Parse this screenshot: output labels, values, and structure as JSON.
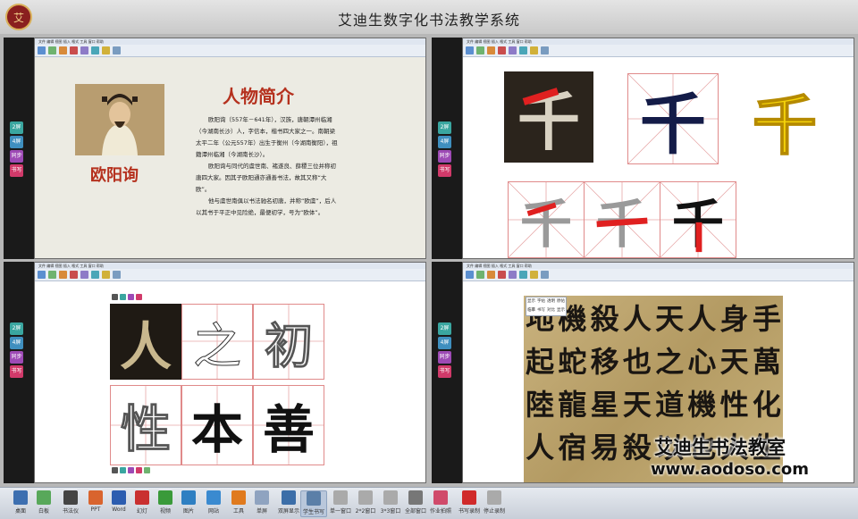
{
  "app": {
    "title": "艾迪生数字化书法教学系统",
    "logo_text": "艾"
  },
  "sidebar": {
    "buttons": [
      "2屏",
      "4屏",
      "同步",
      "书写"
    ]
  },
  "pane_menu": "文件 编辑 视图 插入 格式 工具 窗口 帮助",
  "pane1": {
    "title": "人物简介",
    "name": "欧阳询",
    "paragraphs": [
      "欧阳询（557年－641年），汉族，唐朝潭州临湘（今湖南长沙）人，字信本，楷书四大家之一。南朝梁太平二年（公元557年）出生于衡州（今湖南衡阳），祖籍潭州临湘（今湖南长沙）。",
      "欧阳询与同代的虞世南、褚遂良、薛稷三位并称初唐四大家。因其子欧阳通亦通善书法，故其又称“大欧”。",
      "他与虞世南俱以书法驰名初唐，并称“欧虞”，后人以其书于平正中见险绝，最便初学，号为“欧体”。"
    ]
  },
  "pane2": {
    "char": "千"
  },
  "pane3": {
    "chars": [
      "人",
      "之",
      "初",
      "性",
      "本",
      "善"
    ]
  },
  "pane4": {
    "columns": [
      "手萬化生",
      "身天性人",
      "人心機也",
      "天之道以",
      "人也天殺",
      "殺移星易",
      "機蛇龍宿",
      "地起陸人"
    ],
    "palette": [
      "显示",
      "字帖",
      "透明",
      "原帖",
      "临摹",
      "书写",
      "对比",
      "显示"
    ]
  },
  "watermark": {
    "line1": "艾迪生书法教室",
    "line2": "www.aodoso.com"
  },
  "dock": {
    "items": [
      "桌面",
      "白板",
      "书法仪",
      "PPT",
      "Word",
      "幻灯",
      "视频",
      "图片",
      "网站",
      "工具",
      "单屏",
      "双屏显示",
      "学生书写",
      "单一窗口",
      "2*2窗口",
      "3*3窗口",
      "全部窗口",
      "作业拍照",
      "书写录制",
      "停止录制"
    ],
    "selected": "学生书写"
  },
  "colors": {
    "accent_red": "#b5311e",
    "grid_red": "#e08a8a"
  }
}
